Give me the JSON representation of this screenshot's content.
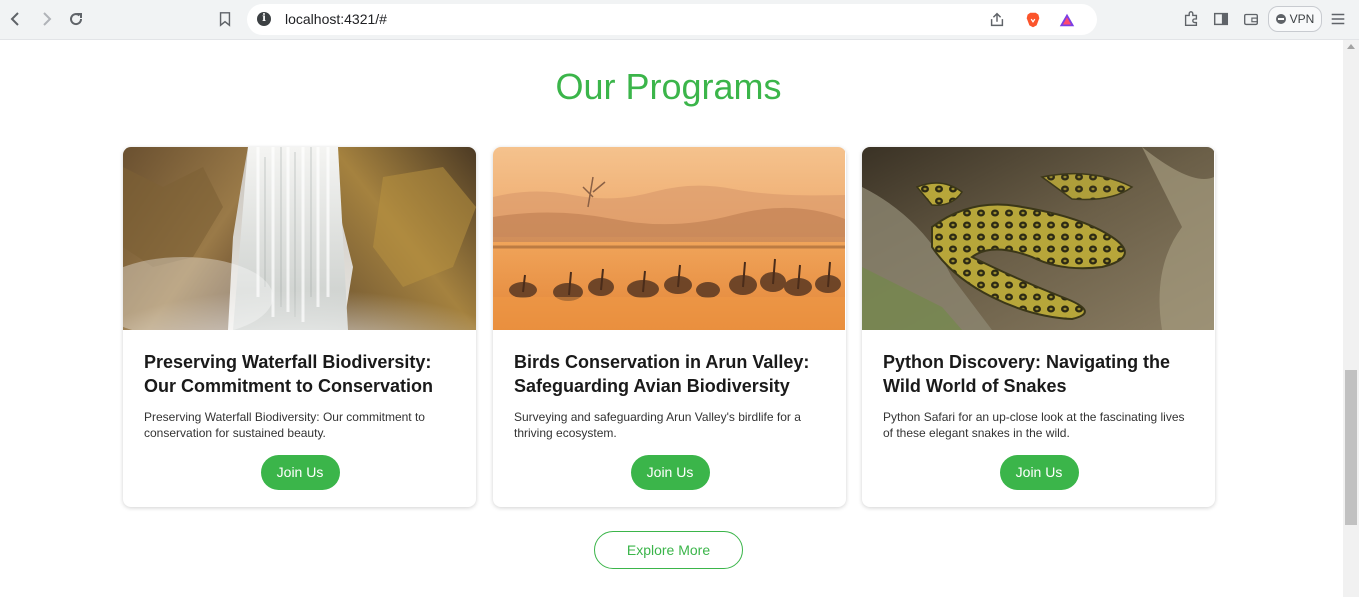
{
  "browser": {
    "url": "localhost:4321/#",
    "vpn_label": "VPN"
  },
  "section": {
    "title": "Our Programs",
    "explore_label": "Explore More"
  },
  "cards": [
    {
      "title": "Preserving Waterfall Biodiversity: Our Commitment to Conservation",
      "description": "Preserving Waterfall Biodiversity: Our commitment to conservation for sustained beauty.",
      "button": "Join Us",
      "image": "waterfall"
    },
    {
      "title": "Birds Conservation in Arun Valley: Safeguarding Avian Biodiversity",
      "description": "Surveying and safeguarding Arun Valley's birdlife for a thriving ecosystem.",
      "button": "Join Us",
      "image": "pelicans-at-sunset"
    },
    {
      "title": "Python Discovery: Navigating the Wild World of Snakes",
      "description": "Python Safari for an up-close look at the fascinating lives of these elegant snakes in the wild.",
      "button": "Join Us",
      "image": "anaconda-python"
    }
  ],
  "colors": {
    "accent": "#3bb54a"
  }
}
